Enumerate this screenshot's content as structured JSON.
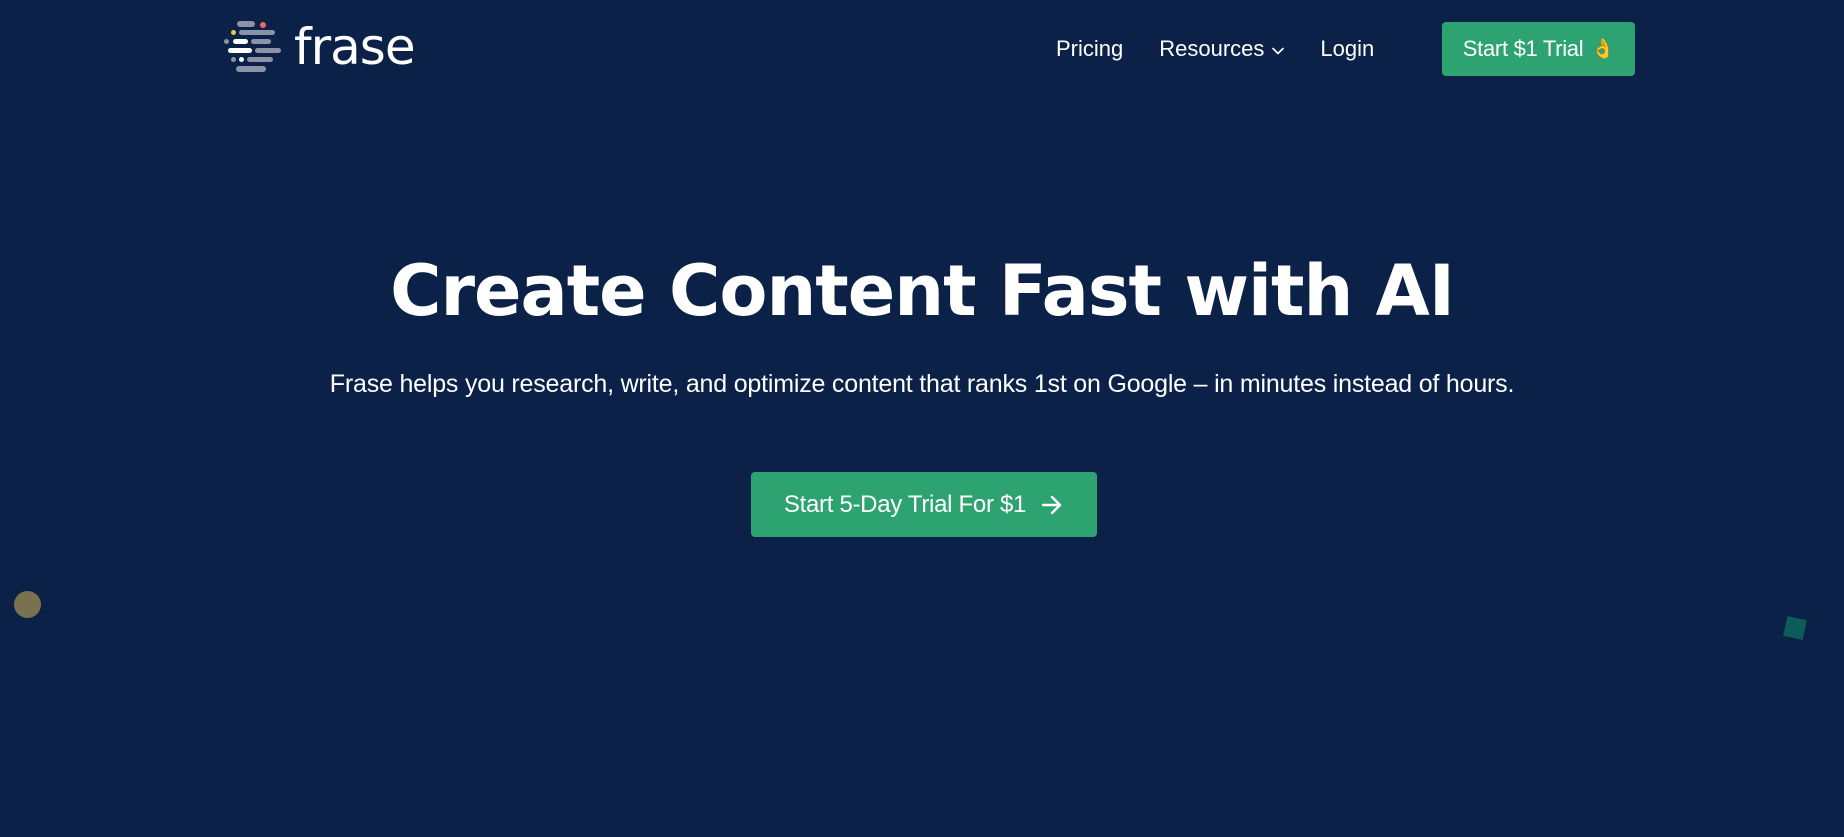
{
  "brand": {
    "name": "frase",
    "logo_icon": "frase-logo-icon"
  },
  "nav": {
    "pricing": "Pricing",
    "resources": "Resources",
    "login": "Login",
    "cta_label": "Start $1 Trial",
    "cta_emoji": "👌"
  },
  "hero": {
    "title": "Create Content Fast with AI",
    "subtitle": "Frase helps you research, write, and optimize content that ranks 1st on Google – in minutes instead of hours.",
    "cta_label": "Start 5-Day Trial For $1",
    "cta_icon": "arrow-right-icon"
  },
  "colors": {
    "background": "#0b2148",
    "accent_green": "#2ea372",
    "text": "#ffffff"
  }
}
